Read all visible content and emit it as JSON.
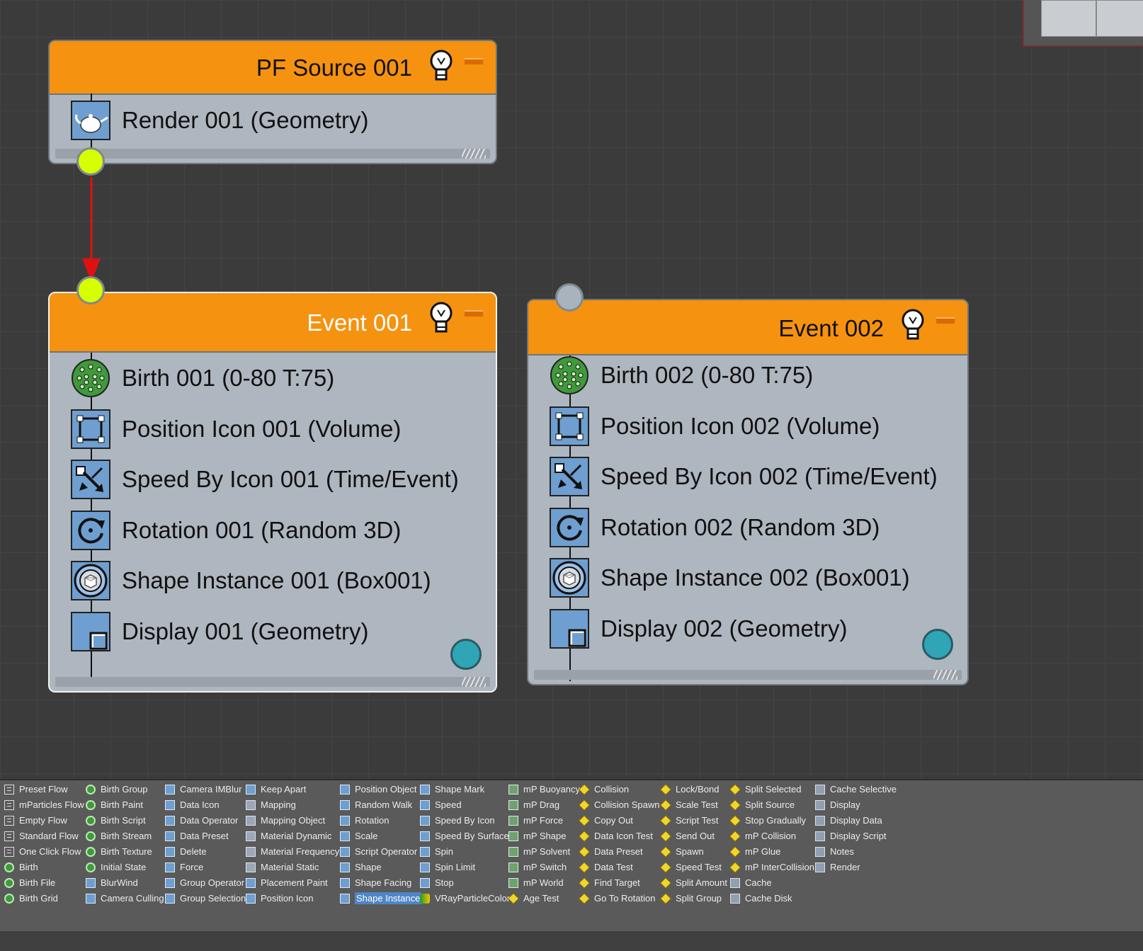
{
  "canvas": {
    "source": {
      "title": "PF Source 001",
      "operators": [
        {
          "label": "Render 001 (Geometry)",
          "icon": "teapot-render-icon"
        }
      ]
    },
    "event1": {
      "title": "Event 001",
      "operators": [
        {
          "label": "Birth 001 (0-80 T:75)",
          "icon": "birth-icon"
        },
        {
          "label": "Position Icon 001 (Volume)",
          "icon": "position-icon"
        },
        {
          "label": "Speed By Icon 001 (Time/Event)",
          "icon": "speed-by-icon-icon"
        },
        {
          "label": "Rotation 001 (Random 3D)",
          "icon": "rotation-icon"
        },
        {
          "label": "Shape Instance 001 (Box001)",
          "icon": "shape-instance-icon"
        },
        {
          "label": "Display 001 (Geometry)",
          "icon": "display-icon"
        }
      ]
    },
    "event2": {
      "title": "Event 002",
      "operators": [
        {
          "label": "Birth 002 (0-80 T:75)",
          "icon": "birth-icon"
        },
        {
          "label": "Position Icon 002 (Volume)",
          "icon": "position-icon"
        },
        {
          "label": "Speed By Icon 002 (Time/Event)",
          "icon": "speed-by-icon-icon"
        },
        {
          "label": "Rotation 002 (Random 3D)",
          "icon": "rotation-icon"
        },
        {
          "label": "Shape Instance 002 (Box001)",
          "icon": "shape-instance-icon"
        },
        {
          "label": "Display 002 (Geometry)",
          "icon": "display-icon"
        }
      ]
    },
    "colors": {
      "header": "#f5920f",
      "body": "#aeb6bf",
      "port_active": "#d6ff00",
      "port_inactive": "#a8b3bd",
      "test_output": "#2fa5b6",
      "wire": "#e01010"
    }
  },
  "depot": {
    "columns": [
      [
        {
          "label": "Preset Flow",
          "icon": "flow"
        },
        {
          "label": "mParticles Flow",
          "icon": "flow"
        },
        {
          "label": "Empty Flow",
          "icon": "flow"
        },
        {
          "label": "Standard Flow",
          "icon": "flow"
        },
        {
          "label": "One Click Flow",
          "icon": "flow"
        },
        {
          "label": "Birth",
          "icon": "birth"
        },
        {
          "label": "Birth File",
          "icon": "birth"
        },
        {
          "label": "Birth Grid",
          "icon": "birth"
        }
      ],
      [
        {
          "label": "Birth Group",
          "icon": "birth"
        },
        {
          "label": "Birth Paint",
          "icon": "birth"
        },
        {
          "label": "Birth Script",
          "icon": "birth"
        },
        {
          "label": "Birth Stream",
          "icon": "birth"
        },
        {
          "label": "Birth Texture",
          "icon": "birth"
        },
        {
          "label": "Initial State",
          "icon": "birth"
        },
        {
          "label": "BlurWind",
          "icon": "op"
        },
        {
          "label": "Camera Culling",
          "icon": "op"
        }
      ],
      [
        {
          "label": "Camera IMBlur",
          "icon": "op"
        },
        {
          "label": "Data Icon",
          "icon": "op"
        },
        {
          "label": "Data Operator",
          "icon": "op"
        },
        {
          "label": "Data Preset",
          "icon": "op"
        },
        {
          "label": "Delete",
          "icon": "op"
        },
        {
          "label": "Force",
          "icon": "op"
        },
        {
          "label": "Group Operator",
          "icon": "op"
        },
        {
          "label": "Group Selection",
          "icon": "op"
        }
      ],
      [
        {
          "label": "Keep Apart",
          "icon": "op"
        },
        {
          "label": "Mapping",
          "icon": "mat"
        },
        {
          "label": "Mapping Object",
          "icon": "mat"
        },
        {
          "label": "Material Dynamic",
          "icon": "mat"
        },
        {
          "label": "Material Frequency",
          "icon": "mat"
        },
        {
          "label": "Material Static",
          "icon": "mat"
        },
        {
          "label": "Placement Paint",
          "icon": "op"
        },
        {
          "label": "Position Icon",
          "icon": "op"
        }
      ],
      [
        {
          "label": "Position Object",
          "icon": "op"
        },
        {
          "label": "Random Walk",
          "icon": "op"
        },
        {
          "label": "Rotation",
          "icon": "op"
        },
        {
          "label": "Scale",
          "icon": "op"
        },
        {
          "label": "Script Operator",
          "icon": "op"
        },
        {
          "label": "Shape",
          "icon": "op"
        },
        {
          "label": "Shape Facing",
          "icon": "op"
        },
        {
          "label": "Shape Instance",
          "icon": "op",
          "selected": true
        }
      ],
      [
        {
          "label": "Shape Mark",
          "icon": "op"
        },
        {
          "label": "Speed",
          "icon": "op"
        },
        {
          "label": "Speed By Icon",
          "icon": "op"
        },
        {
          "label": "Speed By Surface",
          "icon": "op"
        },
        {
          "label": "Spin",
          "icon": "op"
        },
        {
          "label": "Spin Limit",
          "icon": "op"
        },
        {
          "label": "Stop",
          "icon": "op"
        },
        {
          "label": "VRayParticleColor",
          "icon": "vray"
        }
      ],
      [
        {
          "label": "mP Buoyancy",
          "icon": "mp"
        },
        {
          "label": "mP Drag",
          "icon": "mp"
        },
        {
          "label": "mP Force",
          "icon": "mp"
        },
        {
          "label": "mP Shape",
          "icon": "mp"
        },
        {
          "label": "mP Solvent",
          "icon": "mp"
        },
        {
          "label": "mP Switch",
          "icon": "mp"
        },
        {
          "label": "mP World",
          "icon": "mp"
        },
        {
          "label": "Age Test",
          "icon": "test"
        }
      ],
      [
        {
          "label": "Collision",
          "icon": "test"
        },
        {
          "label": "Collision Spawn",
          "icon": "test"
        },
        {
          "label": "Copy Out",
          "icon": "test"
        },
        {
          "label": "Data Icon Test",
          "icon": "test"
        },
        {
          "label": "Data Preset",
          "icon": "test"
        },
        {
          "label": "Data Test",
          "icon": "test"
        },
        {
          "label": "Find Target",
          "icon": "test"
        },
        {
          "label": "Go To Rotation",
          "icon": "test"
        }
      ],
      [
        {
          "label": "Lock/Bond",
          "icon": "test"
        },
        {
          "label": "Scale Test",
          "icon": "test"
        },
        {
          "label": "Script Test",
          "icon": "test"
        },
        {
          "label": "Send Out",
          "icon": "test"
        },
        {
          "label": "Spawn",
          "icon": "test"
        },
        {
          "label": "Speed Test",
          "icon": "test"
        },
        {
          "label": "Split Amount",
          "icon": "test"
        },
        {
          "label": "Split Group",
          "icon": "test"
        }
      ],
      [
        {
          "label": "Split Selected",
          "icon": "test"
        },
        {
          "label": "Split Source",
          "icon": "test"
        },
        {
          "label": "Stop Gradually",
          "icon": "test"
        },
        {
          "label": "mP Collision",
          "icon": "test"
        },
        {
          "label": "mP Glue",
          "icon": "test"
        },
        {
          "label": "mP InterCollision",
          "icon": "test"
        },
        {
          "label": "Cache",
          "icon": "misc"
        },
        {
          "label": "Cache Disk",
          "icon": "misc"
        }
      ],
      [
        {
          "label": "Cache Selective",
          "icon": "misc"
        },
        {
          "label": "Display",
          "icon": "misc"
        },
        {
          "label": "Display Data",
          "icon": "misc"
        },
        {
          "label": "Display Script",
          "icon": "misc"
        },
        {
          "label": "Notes",
          "icon": "misc"
        },
        {
          "label": "Render",
          "icon": "misc"
        }
      ]
    ]
  }
}
